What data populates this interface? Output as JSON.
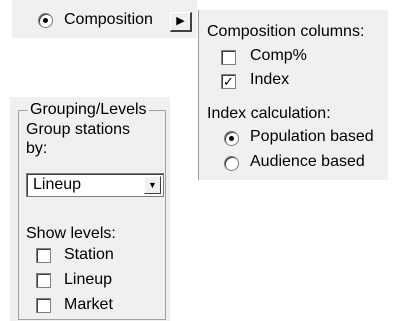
{
  "composition": {
    "radio_label": "Composition",
    "radio_selected": true,
    "expand_icon": "triangle-right-icon"
  },
  "popup": {
    "columns_heading": "Composition columns:",
    "columns": [
      {
        "label": "Comp%",
        "checked": false
      },
      {
        "label": "Index",
        "checked": true
      }
    ],
    "index_heading": "Index calculation:",
    "index_options": [
      {
        "label": "Population based",
        "selected": true
      },
      {
        "label": "Audience based",
        "selected": false
      }
    ]
  },
  "grouping": {
    "group_title": "Grouping/Levels",
    "group_by_label_line1": "Group stations",
    "group_by_label_line2": "by:",
    "group_by_value": "Lineup",
    "show_levels_label": "Show levels:",
    "levels": [
      {
        "label": "Station",
        "checked": false
      },
      {
        "label": "Lineup",
        "checked": false
      },
      {
        "label": "Market",
        "checked": false
      }
    ]
  }
}
